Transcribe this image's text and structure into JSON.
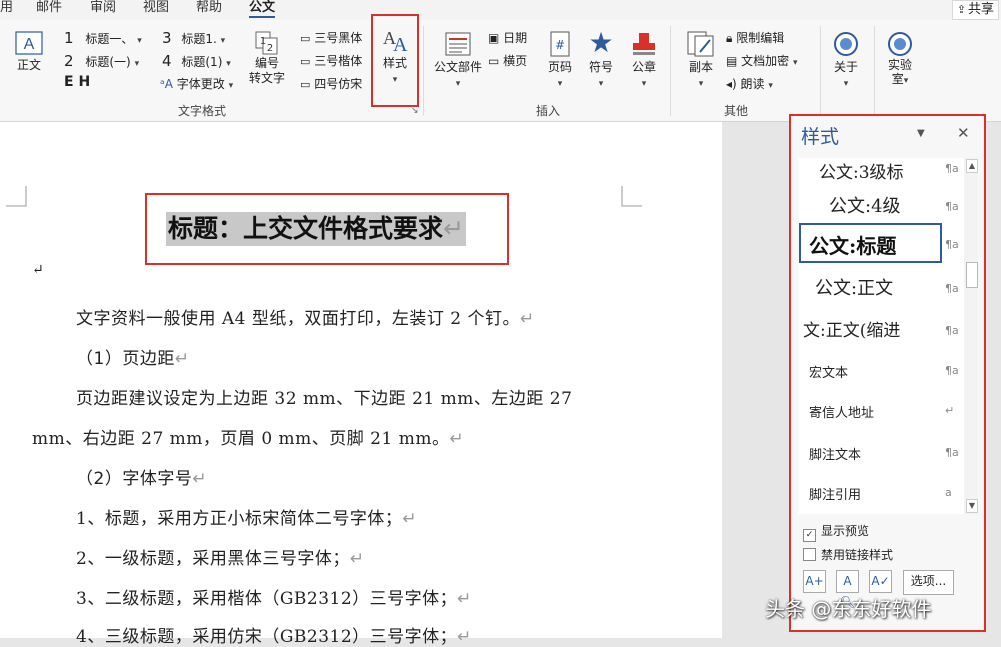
{
  "tabs": [
    "用",
    "邮件",
    "审阅",
    "视图",
    "帮助",
    "公文"
  ],
  "active_tab": "公文",
  "share": {
    "label": "共享"
  },
  "ribbon": {
    "zhengwen": "正文",
    "heading_styles": [
      "标题一、",
      "标题(一)",
      "标题1.",
      "标题(1)"
    ],
    "heading_nums": [
      "1",
      "2",
      "3",
      "4"
    ],
    "e_h": "E H",
    "font_change": "字体更改",
    "numbering_line1": "编号",
    "numbering_line2": "转文字",
    "fonts": [
      "三号黑体",
      "三号楷体",
      "四号仿宋"
    ],
    "style_btn": "样式",
    "group_text_format": "文字格式",
    "doc_parts": "公文部件",
    "date": "日期",
    "landscape": "横页",
    "page_no": "页码",
    "symbol": "符号",
    "seal": "公章",
    "group_insert": "插入",
    "copy": "副本",
    "restrict_edit": "限制编辑",
    "doc_encrypt": "文档加密",
    "read_aloud": "朗读",
    "group_other": "其他",
    "about": "关于",
    "lab_line1": "实验",
    "lab_line2": "室"
  },
  "document": {
    "title": "标题：上交文件格式要求",
    "para_mark": "↵",
    "paragraphs": [
      "文字资料一般使用 A4 型纸，双面打印，左装订 2 个钉。",
      "（1）页边距",
      "页边距建议设定为上边距 32 mm、下边距 21 mm、左边距 27",
      "mm、右边距 27 mm，页眉 0 mm、页脚 21 mm。",
      "（2）字体字号",
      "1、标题，采用方正小标宋简体二号字体；",
      "2、一级标题，采用黑体三号字体；",
      "3、二级标题，采用楷体（GB2312）三号字体；",
      "4、三级标题，采用仿宋（GB2312）三号字体；"
    ]
  },
  "styles_pane": {
    "title": "样式",
    "items": [
      {
        "name": "公文:3级标",
        "mark": "¶a"
      },
      {
        "name": "公文:4级",
        "mark": "¶a"
      },
      {
        "name": "公文:标题",
        "mark": "¶a"
      },
      {
        "name": "公文:正文",
        "mark": "¶a"
      },
      {
        "name": "文:正文(缩进",
        "mark": "¶a"
      },
      {
        "name": "宏文本",
        "mark": "¶a"
      },
      {
        "name": "寄信人地址",
        "mark": "↵"
      },
      {
        "name": "脚注文本",
        "mark": "¶a"
      },
      {
        "name": "脚注引用",
        "mark": "a"
      }
    ],
    "show_preview": "显示预览",
    "disable_linked": "禁用链接样式",
    "options": "选项..."
  },
  "watermark": "头条 @东东好软件",
  "colors": {
    "accent": "#2e5b9e",
    "highlight_red": "#d9302a",
    "selection_gray": "#c8c8c8"
  }
}
